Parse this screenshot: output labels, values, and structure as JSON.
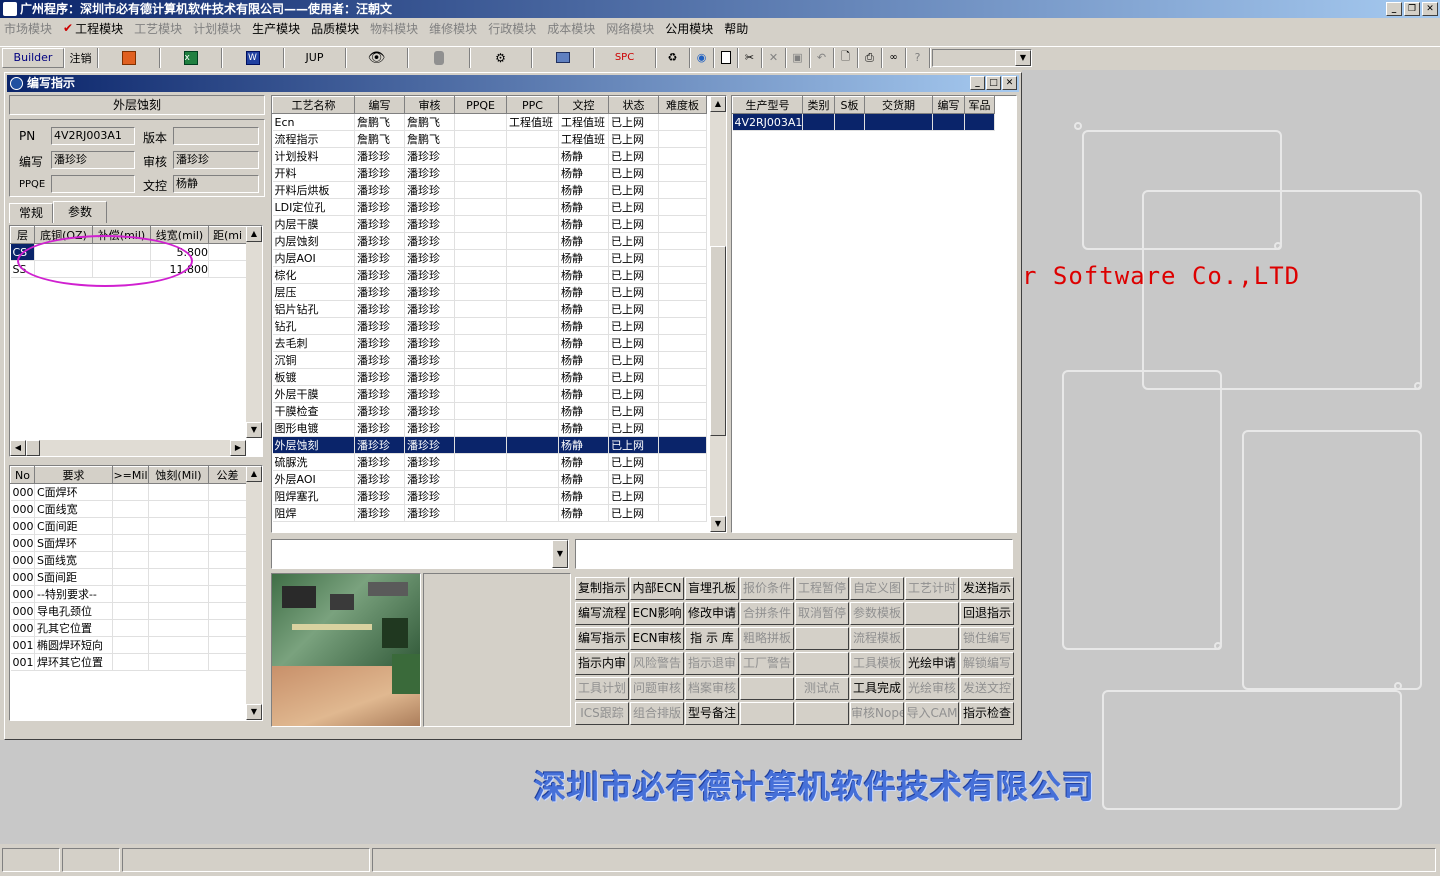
{
  "app": {
    "title": "广州程序：深圳市必有德计算机软件技术有限公司——使用者：汪朝文"
  },
  "menu": [
    {
      "label": "市场模块",
      "disabled": true
    },
    {
      "label": "工程模块",
      "disabled": false,
      "checked": true
    },
    {
      "label": "工艺模块",
      "disabled": true
    },
    {
      "label": "计划模块",
      "disabled": true
    },
    {
      "label": "生产模块",
      "disabled": false
    },
    {
      "label": "品质模块",
      "disabled": false
    },
    {
      "label": "物料模块",
      "disabled": true
    },
    {
      "label": "维修模块",
      "disabled": true
    },
    {
      "label": "行政模块",
      "disabled": true
    },
    {
      "label": "成本模块",
      "disabled": true
    },
    {
      "label": "网络模块",
      "disabled": true
    },
    {
      "label": "公用模块",
      "disabled": false
    },
    {
      "label": "帮助",
      "disabled": false
    }
  ],
  "toolbar": {
    "builder": "Builder",
    "logout": "注销",
    "jup": "JUP",
    "spc": "SPC"
  },
  "child": {
    "title": "编写指示"
  },
  "left": {
    "panel_title": "外层蚀刻",
    "pn_label": "PN",
    "pn_value": "4V2RJ003A1",
    "version_label": "版本",
    "version_value": "",
    "writer_label": "编写",
    "writer_value": "潘珍珍",
    "reviewer_label": "审核",
    "reviewer_value": "潘珍珍",
    "ppqe_label": "PPQE",
    "ppqe_value": "",
    "doc_label": "文控",
    "doc_value": "杨静",
    "tab_normal": "常规",
    "tab_params": "参数",
    "layer_headers": [
      "层",
      "底铜(OZ)",
      "补偿(mil)",
      "线宽(mil)",
      "距(mi"
    ],
    "layer_rows": [
      [
        "CS",
        "",
        "",
        "5.800",
        ""
      ],
      [
        "SS",
        "",
        "",
        "11.800",
        ""
      ]
    ],
    "req_headers": [
      "No",
      "要求",
      ">=Mil",
      "蚀刻(Mil)",
      "公差"
    ],
    "req_rows": [
      [
        "000",
        "C面焊环"
      ],
      [
        "000",
        "C面线宽"
      ],
      [
        "000",
        "C面间距"
      ],
      [
        "000",
        "S面焊环"
      ],
      [
        "000",
        "S面线宽"
      ],
      [
        "000",
        "S面间距"
      ],
      [
        "000",
        "--特别要求--"
      ],
      [
        "000",
        "导电孔颈位"
      ],
      [
        "000",
        "孔其它位置"
      ],
      [
        "001",
        "椭圆焊环短向"
      ],
      [
        "001",
        "焊环其它位置"
      ]
    ]
  },
  "process": {
    "headers": [
      "工艺名称",
      "编写",
      "审核",
      "PPQE",
      "PPC",
      "文控",
      "状态",
      "难度板"
    ],
    "rows": [
      [
        "Ecn",
        "詹鹏飞",
        "詹鹏飞",
        "",
        "工程值班",
        "工程值班",
        "已上网"
      ],
      [
        "流程指示",
        "詹鹏飞",
        "詹鹏飞",
        "",
        "",
        "工程值班",
        "已上网"
      ],
      [
        "计划投料",
        "潘珍珍",
        "潘珍珍",
        "",
        "",
        "杨静",
        "已上网"
      ],
      [
        "开料",
        "潘珍珍",
        "潘珍珍",
        "",
        "",
        "杨静",
        "已上网"
      ],
      [
        "开料后烘板",
        "潘珍珍",
        "潘珍珍",
        "",
        "",
        "杨静",
        "已上网"
      ],
      [
        "LDI定位孔",
        "潘珍珍",
        "潘珍珍",
        "",
        "",
        "杨静",
        "已上网"
      ],
      [
        "内层干膜",
        "潘珍珍",
        "潘珍珍",
        "",
        "",
        "杨静",
        "已上网"
      ],
      [
        "内层蚀刻",
        "潘珍珍",
        "潘珍珍",
        "",
        "",
        "杨静",
        "已上网"
      ],
      [
        "内层AOI",
        "潘珍珍",
        "潘珍珍",
        "",
        "",
        "杨静",
        "已上网"
      ],
      [
        "棕化",
        "潘珍珍",
        "潘珍珍",
        "",
        "",
        "杨静",
        "已上网"
      ],
      [
        "层压",
        "潘珍珍",
        "潘珍珍",
        "",
        "",
        "杨静",
        "已上网"
      ],
      [
        "铝片钻孔",
        "潘珍珍",
        "潘珍珍",
        "",
        "",
        "杨静",
        "已上网"
      ],
      [
        "钻孔",
        "潘珍珍",
        "潘珍珍",
        "",
        "",
        "杨静",
        "已上网"
      ],
      [
        "去毛刺",
        "潘珍珍",
        "潘珍珍",
        "",
        "",
        "杨静",
        "已上网"
      ],
      [
        "沉铜",
        "潘珍珍",
        "潘珍珍",
        "",
        "",
        "杨静",
        "已上网"
      ],
      [
        "板镀",
        "潘珍珍",
        "潘珍珍",
        "",
        "",
        "杨静",
        "已上网"
      ],
      [
        "外层干膜",
        "潘珍珍",
        "潘珍珍",
        "",
        "",
        "杨静",
        "已上网"
      ],
      [
        "干膜检查",
        "潘珍珍",
        "潘珍珍",
        "",
        "",
        "杨静",
        "已上网"
      ],
      [
        "图形电镀",
        "潘珍珍",
        "潘珍珍",
        "",
        "",
        "杨静",
        "已上网"
      ],
      [
        "外层蚀刻",
        "潘珍珍",
        "潘珍珍",
        "",
        "",
        "杨静",
        "已上网"
      ],
      [
        "硫脲洗",
        "潘珍珍",
        "潘珍珍",
        "",
        "",
        "杨静",
        "已上网"
      ],
      [
        "外层AOI",
        "潘珍珍",
        "潘珍珍",
        "",
        "",
        "杨静",
        "已上网"
      ],
      [
        "阻焊塞孔",
        "潘珍珍",
        "潘珍珍",
        "",
        "",
        "杨静",
        "已上网"
      ],
      [
        "阻焊",
        "潘珍珍",
        "潘珍珍",
        "",
        "",
        "杨静",
        "已上网"
      ]
    ],
    "selected_index": 19
  },
  "orders": {
    "headers": [
      "生产型号",
      "类别",
      "S板",
      "交货期",
      "编写",
      "军品"
    ],
    "rows": [
      [
        "4V2RJ003A1",
        "",
        "",
        "",
        "",
        ""
      ]
    ]
  },
  "buttons": [
    [
      {
        "l": "复制指示",
        "e": true
      },
      {
        "l": "内部ECN",
        "e": true
      },
      {
        "l": "盲埋孔板",
        "e": true
      },
      {
        "l": "报价条件",
        "e": false
      },
      {
        "l": "工程暂停",
        "e": false
      },
      {
        "l": "自定义图",
        "e": false
      },
      {
        "l": "工艺计时",
        "e": false
      },
      {
        "l": "发送指示",
        "e": true
      }
    ],
    [
      {
        "l": "编写流程",
        "e": true
      },
      {
        "l": "ECN影响",
        "e": true
      },
      {
        "l": "修改申请",
        "e": true
      },
      {
        "l": "合拼条件",
        "e": false
      },
      {
        "l": "取消暂停",
        "e": false
      },
      {
        "l": "参数模板",
        "e": false
      },
      {
        "l": "",
        "e": false
      },
      {
        "l": "回退指示",
        "e": true
      }
    ],
    [
      {
        "l": "编写指示",
        "e": true
      },
      {
        "l": "ECN审核",
        "e": true
      },
      {
        "l": "指 示 库",
        "e": true
      },
      {
        "l": "粗略拼板",
        "e": false
      },
      {
        "l": "",
        "e": false
      },
      {
        "l": "流程模板",
        "e": false
      },
      {
        "l": "",
        "e": false
      },
      {
        "l": "锁住编写",
        "e": false
      }
    ],
    [
      {
        "l": "指示内审",
        "e": true
      },
      {
        "l": "风险警告",
        "e": false
      },
      {
        "l": "指示退审",
        "e": false
      },
      {
        "l": "工厂警告",
        "e": false
      },
      {
        "l": "",
        "e": false
      },
      {
        "l": "工具模板",
        "e": false
      },
      {
        "l": "光绘申请",
        "e": true
      },
      {
        "l": "解锁编写",
        "e": false
      }
    ],
    [
      {
        "l": "工具计划",
        "e": false
      },
      {
        "l": "问题审核",
        "e": false
      },
      {
        "l": "档案审核",
        "e": false
      },
      {
        "l": "",
        "e": false
      },
      {
        "l": "测试点",
        "e": false
      },
      {
        "l": "工具完成",
        "e": true
      },
      {
        "l": "光绘审核",
        "e": false
      },
      {
        "l": "发送文控",
        "e": false
      }
    ],
    [
      {
        "l": "ICS跟踪",
        "e": false
      },
      {
        "l": "组合排版",
        "e": false
      },
      {
        "l": "型号备注",
        "e": true
      },
      {
        "l": "",
        "e": false
      },
      {
        "l": "",
        "e": false
      },
      {
        "l": "审核Nope",
        "e": false
      },
      {
        "l": "导入CAM",
        "e": false
      },
      {
        "l": "指示检查",
        "e": true
      }
    ]
  ],
  "background": {
    "software_text": "r Software Co.,LTD",
    "company_text": "深圳市必有德计算机软件技术有限公司"
  },
  "colors": {
    "title_active": "#0a246a",
    "selection": "#0a246a",
    "annotation_ellipse": "#d020d0",
    "brand_red": "#dd0000",
    "brand_blue": "#4670d8"
  }
}
